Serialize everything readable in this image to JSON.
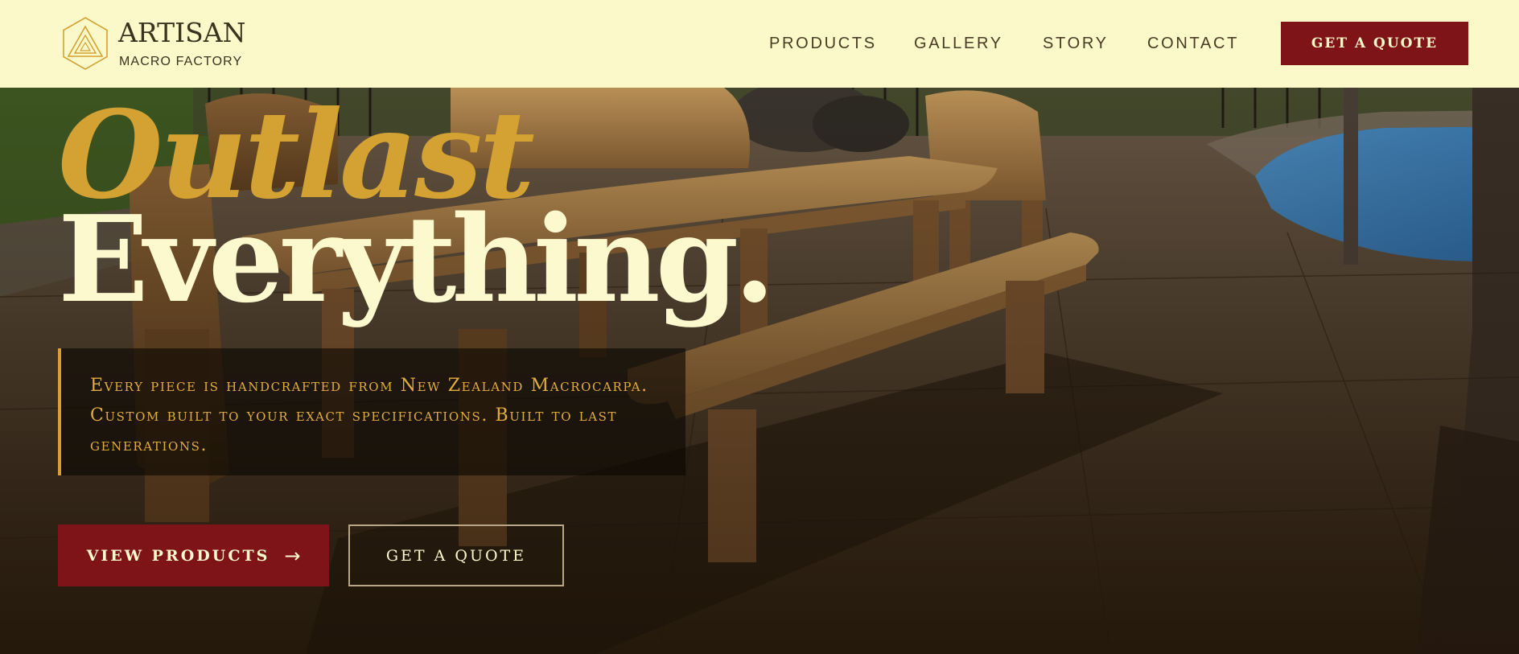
{
  "brand": {
    "name": "ARTISAN",
    "subtitle": "MACRO FACTORY"
  },
  "nav": {
    "links": [
      "PRODUCTS",
      "GALLERY",
      "STORY",
      "CONTACT"
    ],
    "cta_label": "GET A QUOTE"
  },
  "hero": {
    "headline_accent": "Outlast",
    "headline_main": "Everything.",
    "description": "Every piece is handcrafted from New Zealand Macrocarpa. Custom built to your exact specifications. Built to last generations.",
    "primary_button": "VIEW PRODUCTS",
    "primary_button_icon": "→",
    "secondary_button": "GET A QUOTE",
    "photo": "photo of a handcrafted macrocarpa picnic table with benches on a concrete patio beside a pool"
  },
  "colors": {
    "nav_bg": "#fbf8c9",
    "accent_gold": "#d4a232",
    "brand_red": "#7e1418",
    "cream": "#fdf9cf",
    "dark_text": "#4a3b24"
  },
  "icons": {
    "logo": "nested-triangles-hexagon-logo",
    "primary_button": "arrow-right-icon"
  }
}
